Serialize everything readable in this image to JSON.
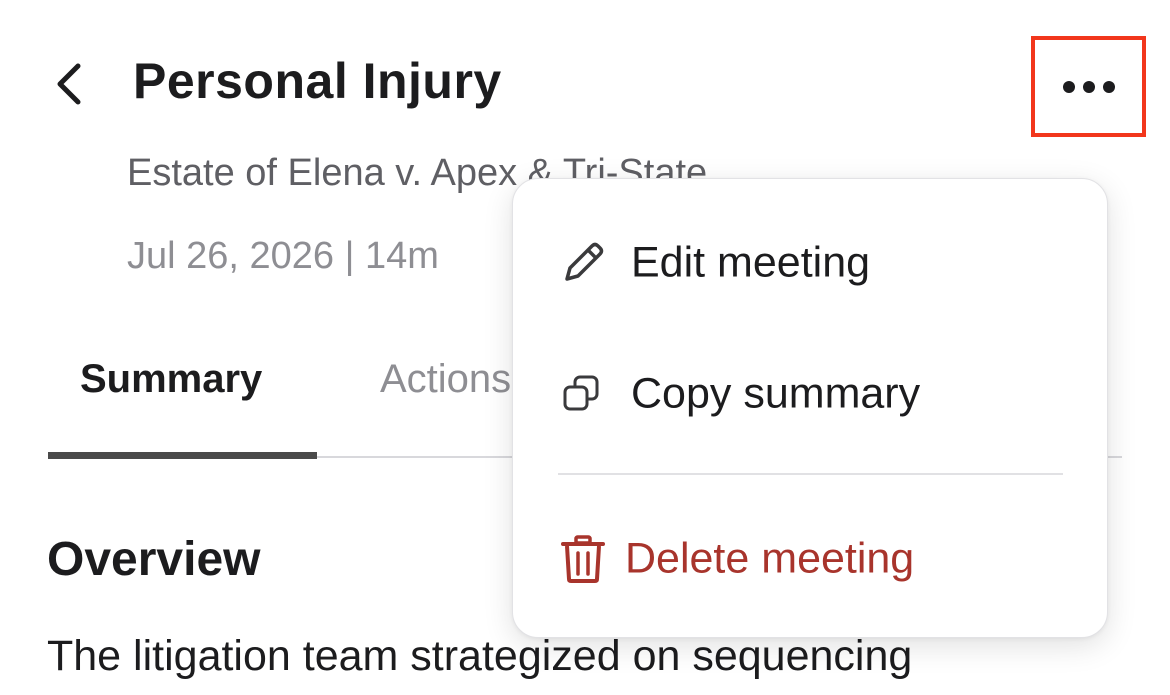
{
  "header": {
    "title": "Personal Injury",
    "back_icon": "chevron-left-icon",
    "more_icon": "ellipsis-icon",
    "highlight_color": "#f2361c"
  },
  "meeting": {
    "subtitle": "Estate of Elena v. Apex & Tri-State",
    "date_duration": "Jul 26, 2026 | 14m"
  },
  "tabs": [
    {
      "label": "Summary",
      "active": true
    },
    {
      "label": "Actions",
      "active": false
    }
  ],
  "content": {
    "section_heading": "Overview",
    "body_first_line": "The litigation team strategized on sequencing"
  },
  "menu": {
    "items": [
      {
        "label": "Edit meeting",
        "icon": "pencil-icon"
      },
      {
        "label": "Copy summary",
        "icon": "copy-icon"
      },
      {
        "label": "Delete meeting",
        "icon": "trash-icon",
        "destructive": true
      }
    ],
    "destructive_color": "#a8342c"
  }
}
